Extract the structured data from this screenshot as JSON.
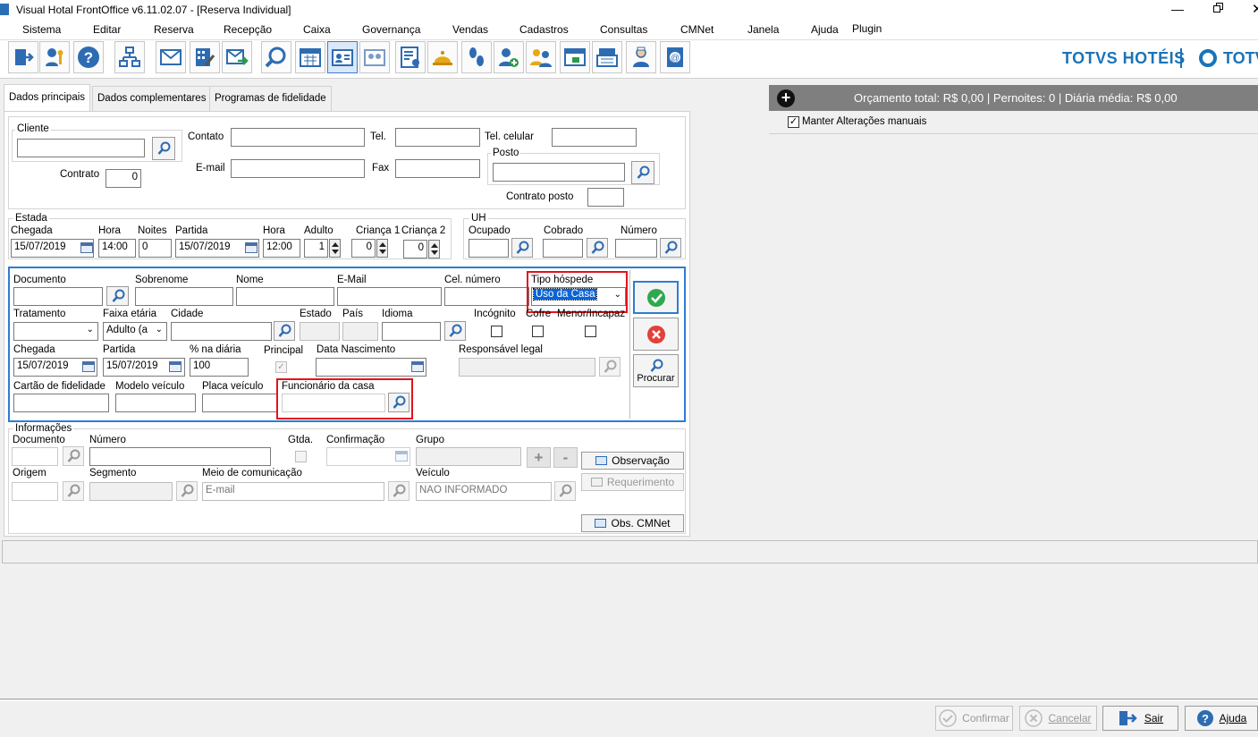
{
  "window": {
    "title": "Visual Hotal FrontOffice v6.11.02.07 - [Reserva Individual]"
  },
  "menu": [
    "Sistema",
    "Editar",
    "Reserva",
    "Recepção",
    "Caixa",
    "Governança",
    "Vendas",
    "Cadastros",
    "Consultas",
    "CMNet",
    "Janela",
    "Ajuda",
    "Plugin"
  ],
  "brand": {
    "left": "TOTVS HOTÉIS",
    "right": "TOTVS",
    "color": "#1a73b8"
  },
  "tabs": [
    "Dados principais",
    "Dados complementares",
    "Programas de fidelidade"
  ],
  "budget": {
    "summary": "Orçamento total: R$ 0,00 | Pernoites: 0 | Diária média: R$ 0,00",
    "keep_manual": "Manter Alterações manuais"
  },
  "client": {
    "cliente_label": "Cliente",
    "contrato_label": "Contrato",
    "contrato_value": "0",
    "contato_label": "Contato",
    "tel_label": "Tel.",
    "tel_celular_label": "Tel. celular",
    "email_label": "E-mail",
    "fax_label": "Fax",
    "posto_label": "Posto",
    "contrato_posto_label": "Contrato posto"
  },
  "stay": {
    "title": "Estada",
    "chegada_label": "Chegada",
    "chegada": "15/07/2019",
    "hora1_label": "Hora",
    "hora1": "14:00",
    "noites_label": "Noites",
    "noites": "0",
    "partida_label": "Partida",
    "partida": "15/07/2019",
    "hora2_label": "Hora",
    "hora2": "12:00",
    "adulto_label": "Adulto",
    "adulto": "1",
    "crianca1_label": "Criança 1",
    "crianca1": "0",
    "crianca2_label": "Criança 2",
    "crianca2": "0"
  },
  "uh": {
    "title": "UH",
    "ocupado_label": "Ocupado",
    "cobrado_label": "Cobrado",
    "numero_label": "Número"
  },
  "guest": {
    "documento_label": "Documento",
    "sobrenome_label": "Sobrenome",
    "nome_label": "Nome",
    "email_label": "E-Mail",
    "cel_label": "Cel. número",
    "tipo_label": "Tipo hóspede",
    "tipo_value": "Uso da Casa",
    "tratamento_label": "Tratamento",
    "faixa_label": "Faixa etária",
    "faixa_value": "Adulto (a",
    "cidade_label": "Cidade",
    "estado_label": "Estado",
    "pais_label": "País",
    "idioma_label": "Idioma",
    "incognito_label": "Incógnito",
    "cofre_label": "Cofre",
    "menor_label": "Menor/Incapaz",
    "chegada_label": "Chegada",
    "chegada": "15/07/2019",
    "partida_label": "Partida",
    "partida": "15/07/2019",
    "pct_label": "% na diária",
    "pct": "100",
    "principal_label": "Principal",
    "nasc_label": "Data Nascimento",
    "resp_label": "Responsável legal",
    "cartao_label": "Cartão de fidelidade",
    "modelo_label": "Modelo veículo",
    "placa_label": "Placa veículo",
    "funcionario_label": "Funcionário da casa",
    "procurar_label": "Procurar"
  },
  "info": {
    "title": "Informações",
    "documento_label": "Documento",
    "numero_label": "Número",
    "gtda_label": "Gtda.",
    "confirmacao_label": "Confirmação",
    "grupo_label": "Grupo",
    "origem_label": "Origem",
    "segmento_label": "Segmento",
    "meio_label": "Meio de comunicação",
    "meio_value": "E-mail",
    "veiculo_label": "Veículo",
    "veiculo_value": "NAO INFORMADO",
    "observacao": "Observação",
    "requerimento": "Requerimento",
    "obs_cmnet": "Obs. CMNet",
    "plus": "+",
    "minus": "-"
  },
  "footer": {
    "confirmar": "Confirmar",
    "cancelar": "Cancelar",
    "sair": "Sair",
    "ajuda": "Ajuda"
  }
}
